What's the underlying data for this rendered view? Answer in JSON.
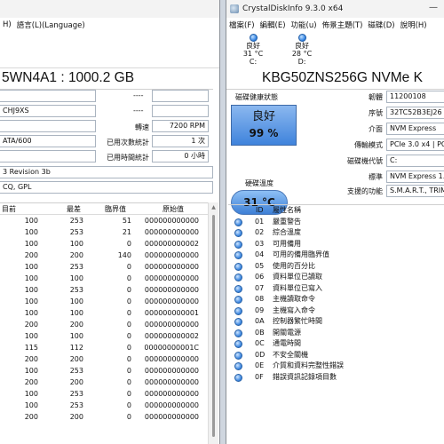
{
  "left": {
    "menu": [
      "H)",
      "語言(L)(Language)"
    ],
    "model": "5WN4A1 : 1000.2 GB",
    "serial": "CHJ9XS",
    "interface": "ATA/600",
    "rotation_label": "轉速",
    "rotation_value": "7200 RPM",
    "power_count_label": "已用次數統計",
    "power_count_value": "1 次",
    "power_hours_label": "已用時間統計",
    "power_hours_value": "0 小時",
    "blank1": "----",
    "blank2": "----",
    "standard": "3 Revision 3b",
    "features": "CQ, GPL",
    "smart_headers": [
      "目前",
      "最差",
      "臨界值",
      "原始值"
    ],
    "smart_rows": [
      [
        "100",
        "253",
        "51",
        "000000000000"
      ],
      [
        "100",
        "253",
        "21",
        "000000000000"
      ],
      [
        "100",
        "100",
        "0",
        "000000000002"
      ],
      [
        "200",
        "200",
        "140",
        "000000000000"
      ],
      [
        "100",
        "253",
        "0",
        "000000000000"
      ],
      [
        "100",
        "100",
        "0",
        "000000000000"
      ],
      [
        "100",
        "253",
        "0",
        "000000000000"
      ],
      [
        "100",
        "100",
        "0",
        "000000000000"
      ],
      [
        "100",
        "100",
        "0",
        "000000000001"
      ],
      [
        "200",
        "200",
        "0",
        "000000000000"
      ],
      [
        "100",
        "100",
        "0",
        "000000000002"
      ],
      [
        "115",
        "112",
        "0",
        "00000000001C"
      ],
      [
        "200",
        "200",
        "0",
        "000000000000"
      ],
      [
        "100",
        "253",
        "0",
        "000000000000"
      ],
      [
        "200",
        "200",
        "0",
        "000000000000"
      ],
      [
        "100",
        "253",
        "0",
        "000000000000"
      ],
      [
        "100",
        "253",
        "0",
        "000000000000"
      ],
      [
        "200",
        "200",
        "0",
        "000000000000"
      ]
    ]
  },
  "right": {
    "title": "CrystalDiskInfo 9.3.0 x64",
    "menu": [
      "檔案(F)",
      "編輯(E)",
      "功能(u)",
      "佈景主題(T)",
      "磁碟(D)",
      "說明(H)"
    ],
    "disks": [
      {
        "status": "良好",
        "temp": "31 °C",
        "letter": "C:"
      },
      {
        "status": "良好",
        "temp": "28 °C",
        "letter": "D:"
      }
    ],
    "model": "KBG50ZNS256G NVMe K",
    "health_label": "磁碟健康狀態",
    "health_status": "良好",
    "health_percent": "99 %",
    "temp_label": "硬碟溫度",
    "temp_value": "31 °C",
    "firmware_label": "韌體",
    "firmware_value": "11200108",
    "serial_label": "序號",
    "serial_value": "32TC52B3EJ26",
    "interface_label": "介面",
    "interface_value": "NVM Express",
    "transfer_label": "傳輸模式",
    "transfer_value": "PCIe 3.0 x4 | PC",
    "drive_letter_label": "磁碟機代號",
    "drive_letter_value": "C:",
    "standard_label": "標準",
    "standard_value": "NVM Express 1.4",
    "features_label": "支援的功能",
    "features_value": "S.M.A.R.T., TRIM",
    "smart_headers": [
      "ID",
      "屬性名稱"
    ],
    "smart_rows": [
      [
        "01",
        "嚴重警告"
      ],
      [
        "02",
        "綜合溫度"
      ],
      [
        "03",
        "可用備用"
      ],
      [
        "04",
        "可用的備用臨界值"
      ],
      [
        "05",
        "使用的百分比"
      ],
      [
        "06",
        "資料單位已讀取"
      ],
      [
        "07",
        "資料單位已寫入"
      ],
      [
        "08",
        "主機讀取命令"
      ],
      [
        "09",
        "主機寫入命令"
      ],
      [
        "0A",
        "控制器繁忙時間"
      ],
      [
        "0B",
        "開關電源"
      ],
      [
        "0C",
        "通電時間"
      ],
      [
        "0D",
        "不安全關機"
      ],
      [
        "0E",
        "介質和資料完整性錯誤"
      ],
      [
        "0F",
        "錯誤資訊記錄項目數"
      ]
    ]
  }
}
